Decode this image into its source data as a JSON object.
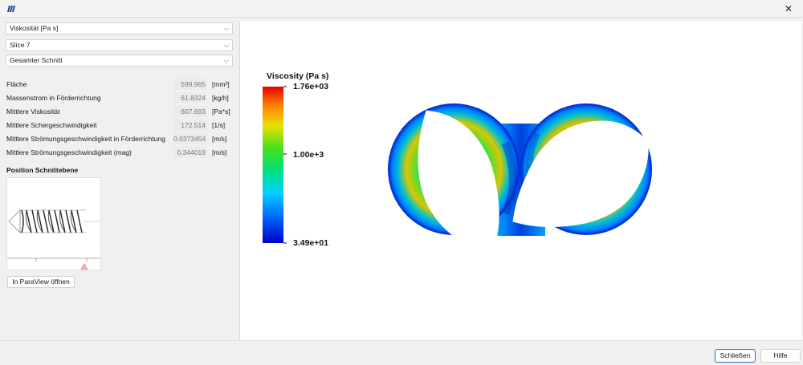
{
  "window": {
    "close_glyph": "✕"
  },
  "controls": {
    "field_select": "Viskosität [Pa s]",
    "slice_select": "Slice 7",
    "region_select": "Gesamter Schnitt"
  },
  "properties": [
    {
      "label": "Fläche",
      "value": "599.965",
      "unit": "[mm²]"
    },
    {
      "label": "Massenstrom in Förderrichtung",
      "value": "61.8324",
      "unit": "[kg/h]"
    },
    {
      "label": "Mittlere Viskosität",
      "value": "607.693",
      "unit": "[Pa*s]"
    },
    {
      "label": "Mittlere Schergeschwindigkeit",
      "value": "172.514",
      "unit": "[1/s]"
    },
    {
      "label": "Mittlere Strömungsgeschwindigkeit in Förderrichtung",
      "value": "0.0373454",
      "unit": "[m/s]"
    },
    {
      "label": "Mittlere Strömungsgeschwindigkeit (mag)",
      "value": "0.344018",
      "unit": "[m/s]"
    }
  ],
  "position_section": {
    "title": "Position Schnittebene"
  },
  "open_paraview_label": "In ParaView öffnen",
  "viewer": {
    "colorbar_title": "Viscosity (Pa s)",
    "colorbar_max": "1.76e+03",
    "colorbar_mid": "1.00e+3",
    "colorbar_min": "3.49e+01"
  },
  "footer": {
    "close_label": "Schließen",
    "help_label": "Hilfe"
  },
  "colors": {
    "accent": "#2f6fbf",
    "colormap": [
      "#0000cc",
      "#00a0ff",
      "#00d8a0",
      "#30e030",
      "#e8e000",
      "#ff8000",
      "#e00000"
    ]
  },
  "icons": [
    "app-logo-icon",
    "close-icon",
    "chevron-down-icon",
    "position-marker-icon"
  ]
}
